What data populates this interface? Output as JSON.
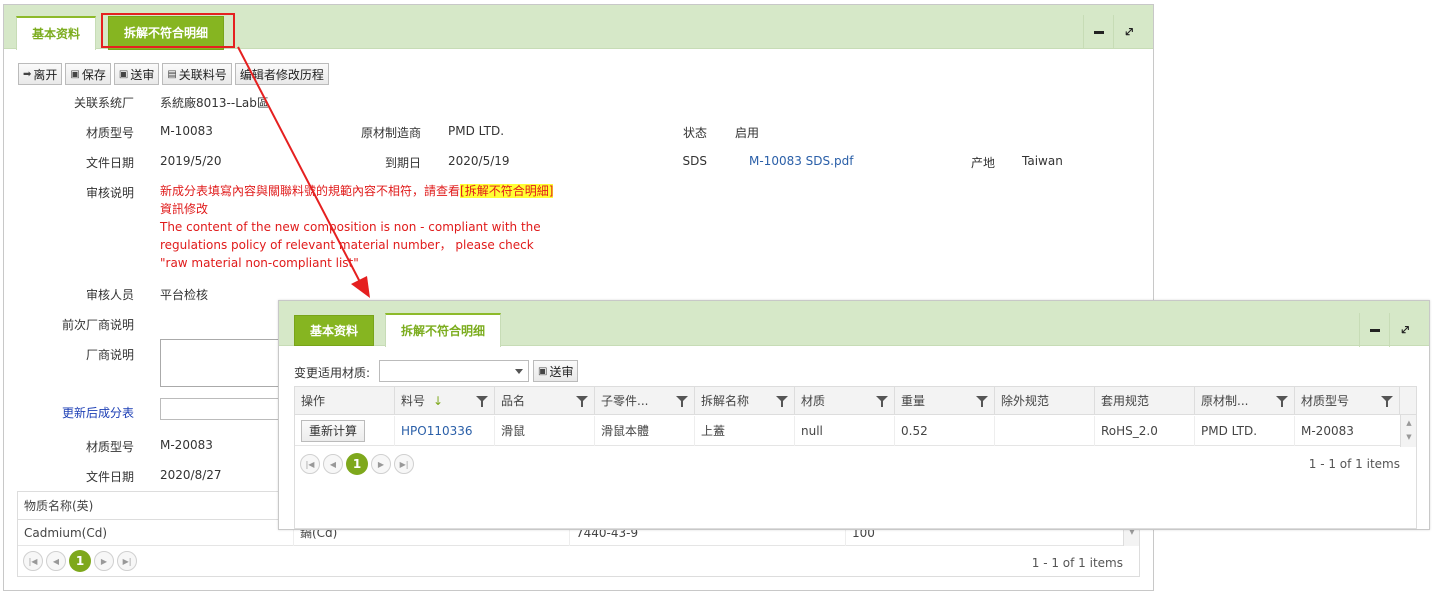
{
  "main": {
    "tabs": [
      {
        "label": "基本资料"
      },
      {
        "label": "拆解不符合明细"
      }
    ],
    "toolbar": {
      "leave": "离开",
      "save": "保存",
      "submit": "送审",
      "link": "关联料号",
      "history": "编辑者修改历程"
    },
    "form": {
      "factory_label": "关联系统厂",
      "factory_value": "系統廠8013--Lab區",
      "model_label": "材质型号",
      "model_value": "M-10083",
      "maker_label": "原材制造商",
      "maker_value": "PMD LTD.",
      "status_label": "状态",
      "status_value": "启用",
      "date_label": "文件日期",
      "date_value": "2019/5/20",
      "expire_label": "到期日",
      "expire_value": "2020/5/19",
      "sds_label": "SDS",
      "sds_value": "M-10083 SDS.pdf",
      "origin_label": "产地",
      "origin_value": "Taiwan",
      "review_label": "审核说明",
      "review_cn_pre": "新成分表填寫內容與關聯料號的規範內容不相符，請查看",
      "review_cn_hl": "[拆解不符合明細]",
      "review_cn_post": "資訊修改",
      "review_en": "The content of the new composition is non - compliant with the regulations policy of relevant material number， please check \"raw material non-compliant list\"",
      "reviewer_label": "审核人员",
      "reviewer_value": "平台检核",
      "prev_vendor_label": "前次厂商说明",
      "vendor_label": "厂商说明",
      "updated_label": "更新后成分表",
      "model2_label": "材质型号",
      "model2_value": "M-20083",
      "date2_label": "文件日期",
      "date2_value": "2020/8/27"
    },
    "grid": {
      "header_first": "物质名称(英)",
      "row": [
        "Cadmium(Cd)",
        "鎘(Cd)",
        "7440-43-9",
        "100"
      ],
      "page": "1",
      "info": "1 - 1 of 1 items"
    }
  },
  "overlay": {
    "tabs": [
      {
        "label": "基本资料"
      },
      {
        "label": "拆解不符合明细"
      }
    ],
    "change_label": "变更适用材质:",
    "submit": "送审",
    "columns": [
      "操作",
      "料号",
      "品名",
      "子零件...",
      "拆解名称",
      "材质",
      "重量",
      "除外规范",
      "套用规范",
      "原材制...",
      "材质型号"
    ],
    "row": {
      "action": "重新计算",
      "part_no": "HPO110336",
      "name": "滑鼠",
      "sub_part": "滑鼠本體",
      "disassembly": "上蓋",
      "material": "null",
      "weight": "0.52",
      "exclude": "",
      "apply": "RoHS_2.0",
      "maker": "PMD LTD.",
      "model": "M-20083"
    },
    "page": "1",
    "info": "1 - 1 of 1 items"
  }
}
